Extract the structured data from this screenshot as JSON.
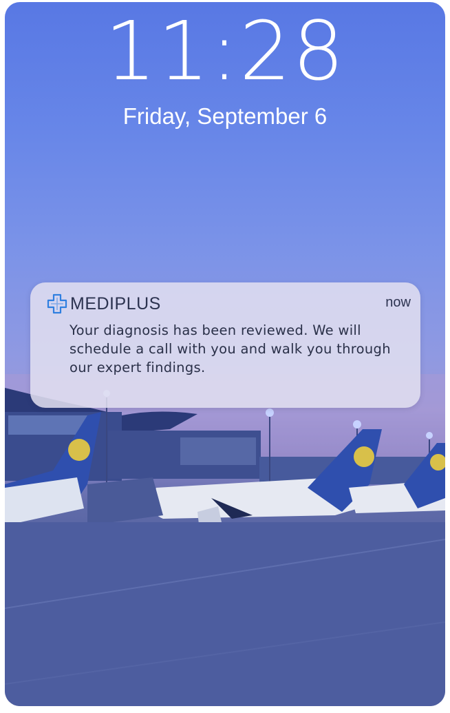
{
  "lock_screen": {
    "time": "11:28",
    "date": "Friday, September 6"
  },
  "notification": {
    "app_icon": "medical-cross-icon",
    "app_name": "MEDIPLUS",
    "timestamp": "now",
    "message": "Your diagnosis has been reviewed. We will schedule a call with you and walk you through our expert findings."
  },
  "colors": {
    "icon_blue": "#2f7fe0",
    "notification_bg": "#e2e0f0",
    "text_dark": "#2a3048"
  }
}
